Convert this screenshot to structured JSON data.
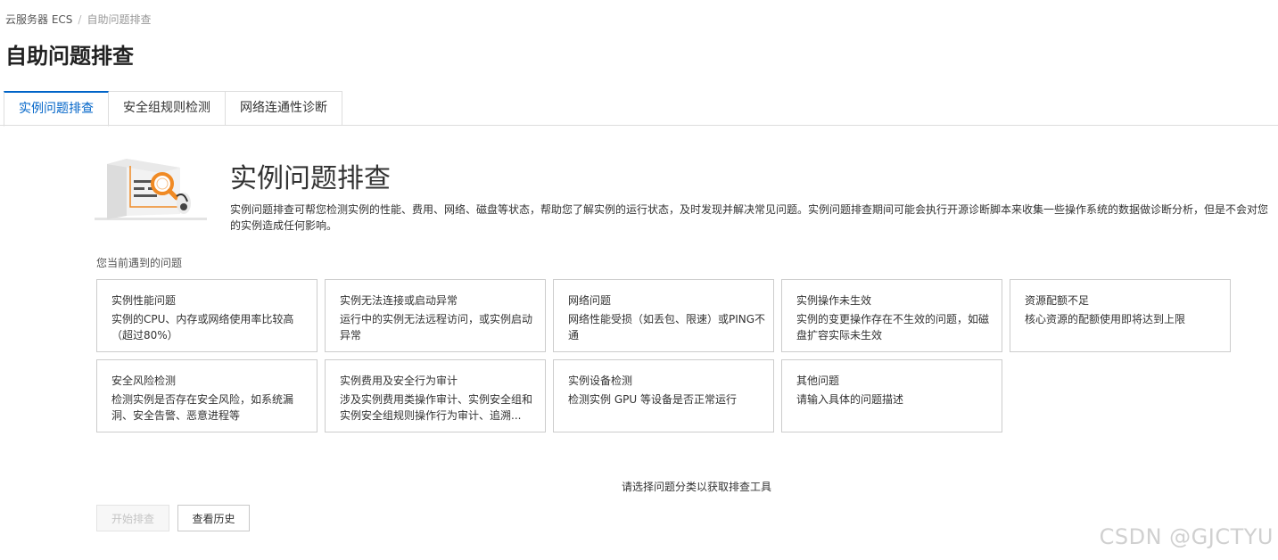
{
  "breadcrumb": {
    "root": "云服务器 ECS",
    "separator": "/",
    "current": "自助问题排查"
  },
  "page_title": "自助问题排查",
  "tabs": [
    {
      "label": "实例问题排查",
      "active": true
    },
    {
      "label": "安全组规则检测",
      "active": false
    },
    {
      "label": "网络连通性诊断",
      "active": false
    }
  ],
  "hero": {
    "title": "实例问题排查",
    "description": "实例问题排查可帮您检测实例的性能、费用、网络、磁盘等状态，帮助您了解实例的运行状态，及时发现并解决常见问题。实例问题排查期间可能会执行开源诊断脚本来收集一些操作系统的数据做诊断分析，但是不会对您的实例造成任何影响。",
    "illustration_icon": "diagnosis-magnifier-illustration"
  },
  "section_label": "您当前遇到的问题",
  "cards": [
    {
      "title": "实例性能问题",
      "desc": "实例的CPU、内存或网络使用率比较高（超过80%）"
    },
    {
      "title": "实例无法连接或启动异常",
      "desc": "运行中的实例无法远程访问，或实例启动异常"
    },
    {
      "title": "网络问题",
      "desc": "网络性能受损（如丢包、限速）或PING不通"
    },
    {
      "title": "实例操作未生效",
      "desc": "实例的变更操作存在不生效的问题，如磁盘扩容实际未生效"
    },
    {
      "title": "资源配额不足",
      "desc": "核心资源的配额使用即将达到上限"
    },
    {
      "title": "安全风险检测",
      "desc": "检测实例是否存在安全风险，如系统漏洞、安全告警、恶意进程等"
    },
    {
      "title": "实例费用及安全行为审计",
      "desc": "涉及实例费用类操作审计、实例安全组和实例安全组规则操作行为审计、追溯..."
    },
    {
      "title": "实例设备检测",
      "desc": "检测实例 GPU 等设备是否正常运行"
    },
    {
      "title": "其他问题",
      "desc": "请输入具体的问题描述"
    }
  ],
  "hint": "请选择问题分类以获取排查工具",
  "buttons": {
    "start": "开始排查",
    "history": "查看历史"
  },
  "watermark": "CSDN @GJCTYU",
  "colors": {
    "accent": "#0064c8",
    "illustration_orange": "#f08a24"
  }
}
